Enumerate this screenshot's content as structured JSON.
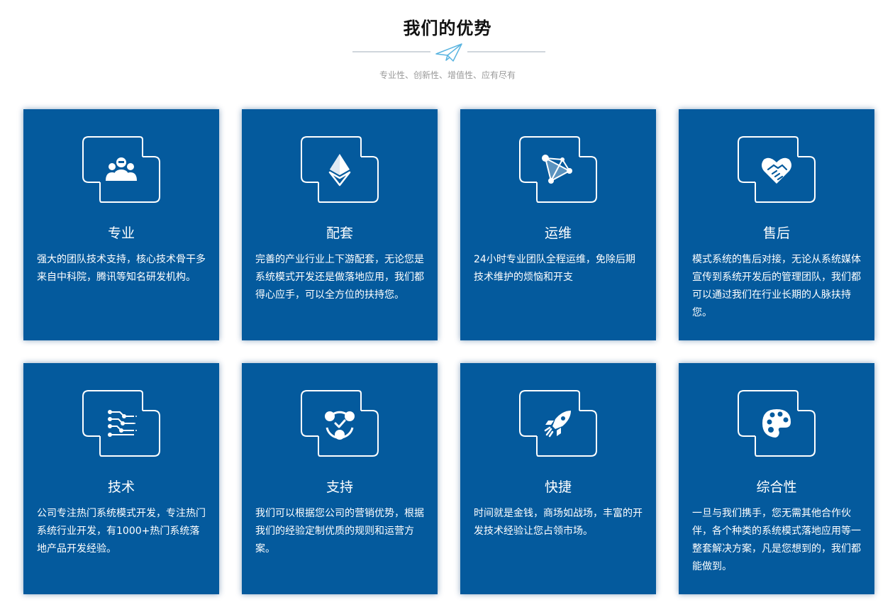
{
  "header": {
    "title": "我们的优势",
    "subtitle": "专业性、创新性、增值性、应有尽有"
  },
  "colors": {
    "card_bg": "#045a9d",
    "divider": "#d0d6dc",
    "plane": "#5ab4e0"
  },
  "cards": [
    {
      "icon": "team-icon",
      "title": "专业",
      "desc": "强大的团队技术支持，核心技术骨干多来自中科院，腾讯等知名研发机构。"
    },
    {
      "icon": "ethereum-icon",
      "title": "配套",
      "desc": "完善的产业行业上下游配套，无论您是系统模式开发还是做落地应用，我们都得心应手，可以全方位的扶持您。"
    },
    {
      "icon": "network-icon",
      "title": "运维",
      "desc": "24小时专业团队全程运维，免除后期技术维护的烦恼和开支"
    },
    {
      "icon": "handshake-heart-icon",
      "title": "售后",
      "desc": "模式系统的售后对接，无论从系统媒体宣传到系统开发后的管理团队，我们都可以通过我们在行业长期的人脉扶持您。"
    },
    {
      "icon": "circuit-icon",
      "title": "技术",
      "desc": "公司专注热门系统模式开发，专注热门系统行业开发，有1000+热门系统落地产品开发经验。"
    },
    {
      "icon": "support-cycle-icon",
      "title": "支持",
      "desc": "我们可以根据您公司的营销优势，根据我们的经验定制优质的规则和运营方案。"
    },
    {
      "icon": "rocket-icon",
      "title": "快捷",
      "desc": "时间就是金钱，商场如战场，丰富的开发技术经验让您占领市场。"
    },
    {
      "icon": "palette-icon",
      "title": "综合性",
      "desc": "一旦与我们携手，您无需其他合作伙伴，各个种类的系统模式落地应用等一整套解决方案，凡是您想到的，我们都能做到。"
    }
  ]
}
